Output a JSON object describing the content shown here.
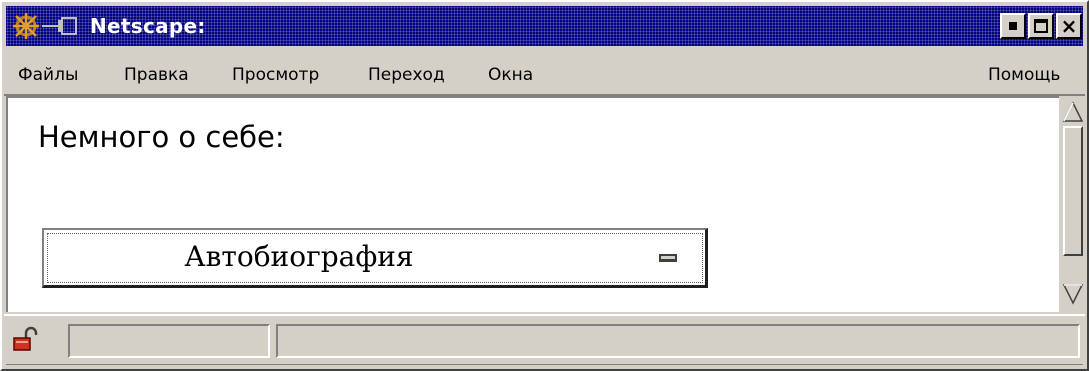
{
  "window": {
    "title": "Netscape:",
    "icon": "netscape-wheel-icon",
    "controls": [
      "minimize",
      "maximize",
      "close"
    ],
    "close_glyph": "×"
  },
  "menubar": {
    "items": [
      "Файлы",
      "Правка",
      "Просмотр",
      "Переход",
      "Окна"
    ],
    "help": "Помощь"
  },
  "page": {
    "heading": "Немного о себе:",
    "select": {
      "value": "Автобиография",
      "icon": "option-menu-indicator-icon"
    }
  },
  "statusbar": {
    "security_icon": "unlocked-padlock-icon",
    "progress_text": "",
    "message_text": ""
  },
  "colors": {
    "titlebar": "#000080",
    "chrome": "#d4d0c8",
    "content_bg": "#ffffff"
  }
}
